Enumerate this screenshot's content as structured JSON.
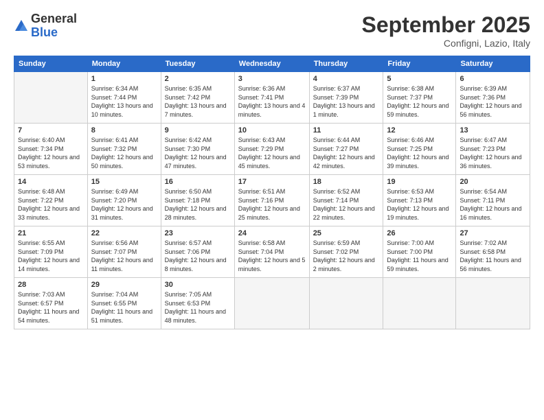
{
  "header": {
    "logo": {
      "general": "General",
      "blue": "Blue"
    },
    "title": "September 2025",
    "location": "Configni, Lazio, Italy"
  },
  "weekdays": [
    "Sunday",
    "Monday",
    "Tuesday",
    "Wednesday",
    "Thursday",
    "Friday",
    "Saturday"
  ],
  "weeks": [
    [
      {
        "day": "",
        "empty": true
      },
      {
        "day": "1",
        "sunrise": "Sunrise: 6:34 AM",
        "sunset": "Sunset: 7:44 PM",
        "daylight": "Daylight: 13 hours and 10 minutes."
      },
      {
        "day": "2",
        "sunrise": "Sunrise: 6:35 AM",
        "sunset": "Sunset: 7:42 PM",
        "daylight": "Daylight: 13 hours and 7 minutes."
      },
      {
        "day": "3",
        "sunrise": "Sunrise: 6:36 AM",
        "sunset": "Sunset: 7:41 PM",
        "daylight": "Daylight: 13 hours and 4 minutes."
      },
      {
        "day": "4",
        "sunrise": "Sunrise: 6:37 AM",
        "sunset": "Sunset: 7:39 PM",
        "daylight": "Daylight: 13 hours and 1 minute."
      },
      {
        "day": "5",
        "sunrise": "Sunrise: 6:38 AM",
        "sunset": "Sunset: 7:37 PM",
        "daylight": "Daylight: 12 hours and 59 minutes."
      },
      {
        "day": "6",
        "sunrise": "Sunrise: 6:39 AM",
        "sunset": "Sunset: 7:36 PM",
        "daylight": "Daylight: 12 hours and 56 minutes."
      }
    ],
    [
      {
        "day": "7",
        "sunrise": "Sunrise: 6:40 AM",
        "sunset": "Sunset: 7:34 PM",
        "daylight": "Daylight: 12 hours and 53 minutes."
      },
      {
        "day": "8",
        "sunrise": "Sunrise: 6:41 AM",
        "sunset": "Sunset: 7:32 PM",
        "daylight": "Daylight: 12 hours and 50 minutes."
      },
      {
        "day": "9",
        "sunrise": "Sunrise: 6:42 AM",
        "sunset": "Sunset: 7:30 PM",
        "daylight": "Daylight: 12 hours and 47 minutes."
      },
      {
        "day": "10",
        "sunrise": "Sunrise: 6:43 AM",
        "sunset": "Sunset: 7:29 PM",
        "daylight": "Daylight: 12 hours and 45 minutes."
      },
      {
        "day": "11",
        "sunrise": "Sunrise: 6:44 AM",
        "sunset": "Sunset: 7:27 PM",
        "daylight": "Daylight: 12 hours and 42 minutes."
      },
      {
        "day": "12",
        "sunrise": "Sunrise: 6:46 AM",
        "sunset": "Sunset: 7:25 PM",
        "daylight": "Daylight: 12 hours and 39 minutes."
      },
      {
        "day": "13",
        "sunrise": "Sunrise: 6:47 AM",
        "sunset": "Sunset: 7:23 PM",
        "daylight": "Daylight: 12 hours and 36 minutes."
      }
    ],
    [
      {
        "day": "14",
        "sunrise": "Sunrise: 6:48 AM",
        "sunset": "Sunset: 7:22 PM",
        "daylight": "Daylight: 12 hours and 33 minutes."
      },
      {
        "day": "15",
        "sunrise": "Sunrise: 6:49 AM",
        "sunset": "Sunset: 7:20 PM",
        "daylight": "Daylight: 12 hours and 31 minutes."
      },
      {
        "day": "16",
        "sunrise": "Sunrise: 6:50 AM",
        "sunset": "Sunset: 7:18 PM",
        "daylight": "Daylight: 12 hours and 28 minutes."
      },
      {
        "day": "17",
        "sunrise": "Sunrise: 6:51 AM",
        "sunset": "Sunset: 7:16 PM",
        "daylight": "Daylight: 12 hours and 25 minutes."
      },
      {
        "day": "18",
        "sunrise": "Sunrise: 6:52 AM",
        "sunset": "Sunset: 7:14 PM",
        "daylight": "Daylight: 12 hours and 22 minutes."
      },
      {
        "day": "19",
        "sunrise": "Sunrise: 6:53 AM",
        "sunset": "Sunset: 7:13 PM",
        "daylight": "Daylight: 12 hours and 19 minutes."
      },
      {
        "day": "20",
        "sunrise": "Sunrise: 6:54 AM",
        "sunset": "Sunset: 7:11 PM",
        "daylight": "Daylight: 12 hours and 16 minutes."
      }
    ],
    [
      {
        "day": "21",
        "sunrise": "Sunrise: 6:55 AM",
        "sunset": "Sunset: 7:09 PM",
        "daylight": "Daylight: 12 hours and 14 minutes."
      },
      {
        "day": "22",
        "sunrise": "Sunrise: 6:56 AM",
        "sunset": "Sunset: 7:07 PM",
        "daylight": "Daylight: 12 hours and 11 minutes."
      },
      {
        "day": "23",
        "sunrise": "Sunrise: 6:57 AM",
        "sunset": "Sunset: 7:06 PM",
        "daylight": "Daylight: 12 hours and 8 minutes."
      },
      {
        "day": "24",
        "sunrise": "Sunrise: 6:58 AM",
        "sunset": "Sunset: 7:04 PM",
        "daylight": "Daylight: 12 hours and 5 minutes."
      },
      {
        "day": "25",
        "sunrise": "Sunrise: 6:59 AM",
        "sunset": "Sunset: 7:02 PM",
        "daylight": "Daylight: 12 hours and 2 minutes."
      },
      {
        "day": "26",
        "sunrise": "Sunrise: 7:00 AM",
        "sunset": "Sunset: 7:00 PM",
        "daylight": "Daylight: 11 hours and 59 minutes."
      },
      {
        "day": "27",
        "sunrise": "Sunrise: 7:02 AM",
        "sunset": "Sunset: 6:58 PM",
        "daylight": "Daylight: 11 hours and 56 minutes."
      }
    ],
    [
      {
        "day": "28",
        "sunrise": "Sunrise: 7:03 AM",
        "sunset": "Sunset: 6:57 PM",
        "daylight": "Daylight: 11 hours and 54 minutes."
      },
      {
        "day": "29",
        "sunrise": "Sunrise: 7:04 AM",
        "sunset": "Sunset: 6:55 PM",
        "daylight": "Daylight: 11 hours and 51 minutes."
      },
      {
        "day": "30",
        "sunrise": "Sunrise: 7:05 AM",
        "sunset": "Sunset: 6:53 PM",
        "daylight": "Daylight: 11 hours and 48 minutes."
      },
      {
        "day": "",
        "empty": true
      },
      {
        "day": "",
        "empty": true
      },
      {
        "day": "",
        "empty": true
      },
      {
        "day": "",
        "empty": true
      }
    ]
  ]
}
